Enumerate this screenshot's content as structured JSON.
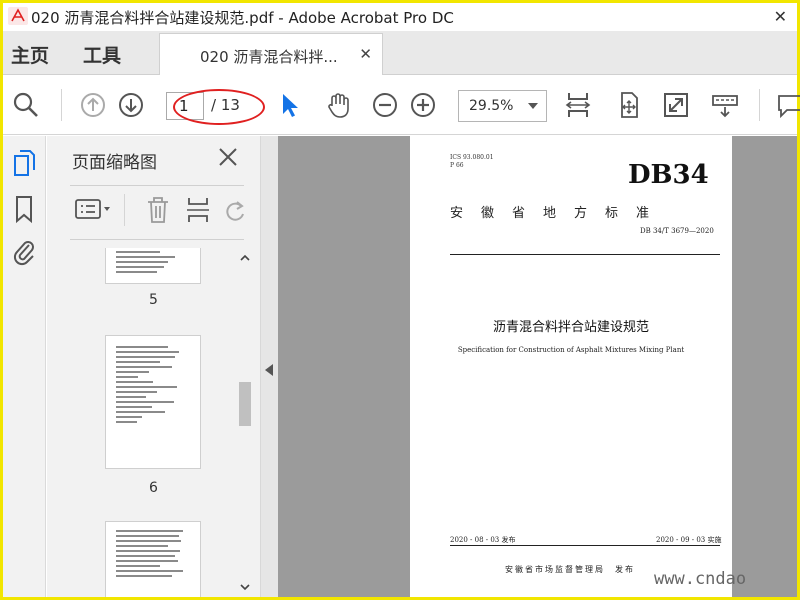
{
  "window": {
    "title": "020 沥青混合料拌合站建设规范.pdf - Adobe Acrobat Pro DC",
    "close_glyph": "✕"
  },
  "nav": {
    "home": "主页",
    "tools": "工具",
    "doc_tab": "020 沥青混合料拌...",
    "doc_tab_close": "✕"
  },
  "toolbar": {
    "current_page": "1",
    "total_pages": "/ 13",
    "zoom": "29.5%"
  },
  "icons": {
    "accent_color": "#1473e6",
    "annotation_color": "#e02020"
  },
  "thumbnails": {
    "title": "页面缩略图",
    "pages": [
      {
        "number": "5"
      },
      {
        "number": "6"
      }
    ]
  },
  "document": {
    "ics": "ICS 93.080.01",
    "p_code": "P 66",
    "std_code": "DB34",
    "province": "安徽省地方标准",
    "std_number": "DB 34/T 3679—2020",
    "title": "沥青混合料拌合站建设规范",
    "subtitle": "Specification for Construction of Asphalt Mixtures Mixing Plant",
    "published": "2020 - 08 - 03 发布",
    "implemented": "2020 - 09 - 03 实施",
    "issuer": "安徽省市场监督管理局　发布"
  },
  "watermark": "www.cndao"
}
